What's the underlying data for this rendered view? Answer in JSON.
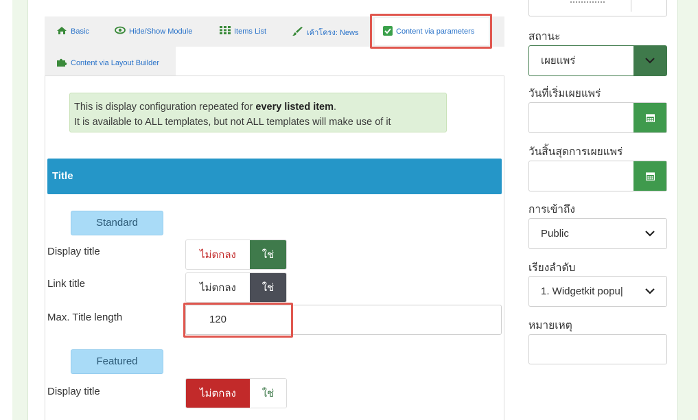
{
  "tabs": [
    {
      "label": "Basic",
      "icon": "home-icon"
    },
    {
      "label": "Hide/Show Module",
      "icon": "eye-icon"
    },
    {
      "label": "Items List",
      "icon": "grid-icon"
    },
    {
      "label": "เค้าโครง: News",
      "icon": "brush-icon"
    },
    {
      "label": "Content via parameters",
      "icon": "checkbox-icon"
    },
    {
      "label": "Content via Layout Builder",
      "icon": "puzzle-icon"
    }
  ],
  "info": {
    "line1_prefix": "This is display configuration repeated for ",
    "line1_bold": "every listed item",
    "line1_suffix": ".",
    "line2": "It is available to ALL templates, but not ALL templates will make use of it"
  },
  "section": {
    "title": "Title"
  },
  "standard": {
    "label": "Standard",
    "display_title": {
      "label": "Display title",
      "no": "ไม่ตกลง",
      "yes": "ใช่",
      "selected": "yes"
    },
    "link_title": {
      "label": "Link title",
      "no": "ไม่ตกลง",
      "yes": "ใช่",
      "selected": "yes"
    },
    "max_title_length": {
      "label": "Max. Title length",
      "value": "120"
    }
  },
  "featured": {
    "label": "Featured",
    "display_title": {
      "label": "Display title",
      "no": "ไม่ตกลง",
      "yes": "ใช่",
      "selected": "no"
    }
  },
  "sidebar": {
    "status_label": "สถานะ",
    "status_value": "เผยแพร่",
    "publish_start_label": "วันที่เริ่มเผยแพร่",
    "publish_start_value": "",
    "publish_end_label": "วันสิ้นสุดการเผยแพร่",
    "publish_end_value": "",
    "access_label": "การเข้าถึง",
    "access_value": "Public",
    "ordering_label": "เรียงลำดับ",
    "ordering_value": "1. Widgetkit popu|",
    "note_label": "หมายเหตุ",
    "note_value": ""
  },
  "colors": {
    "accent_green": "#3f7a4b",
    "tab_link": "#2a73c9",
    "section_blue": "#2596c8",
    "yes_green": "#3f7a4b",
    "yes_dark": "#4b4e57",
    "no_red": "#c22a2a",
    "highlight": "#e0574f"
  }
}
